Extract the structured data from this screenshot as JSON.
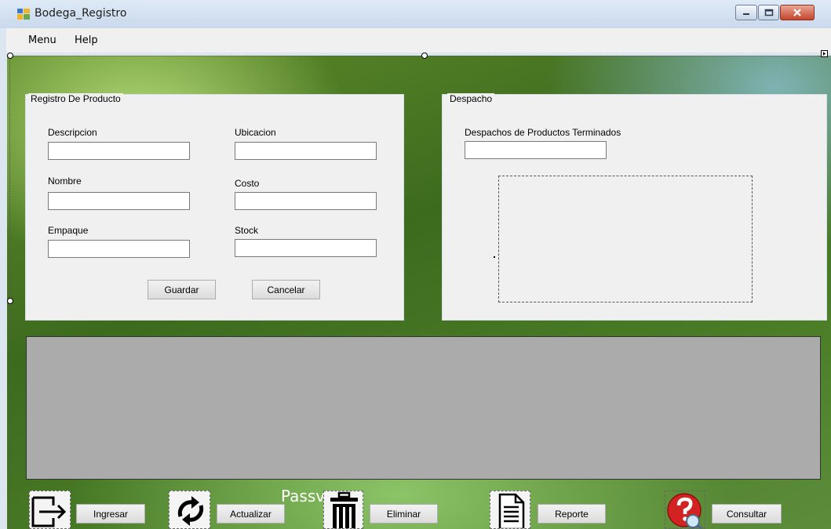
{
  "window": {
    "title": "Bodega_Registro"
  },
  "menu": {
    "items": [
      {
        "label": "Menu"
      },
      {
        "label": "Help"
      }
    ]
  },
  "registro": {
    "title": "Registro De Producto",
    "fields": {
      "descripcion": {
        "label": "Descripcion",
        "value": ""
      },
      "ubicacion": {
        "label": "Ubicacion",
        "value": ""
      },
      "nombre": {
        "label": "Nombre",
        "value": ""
      },
      "costo": {
        "label": "Costo",
        "value": ""
      },
      "empaque": {
        "label": "Empaque",
        "value": ""
      },
      "stock": {
        "label": "Stock",
        "value": ""
      }
    },
    "guardar_label": "Guardar",
    "cancelar_label": "Cancelar"
  },
  "despacho": {
    "title": "Despacho",
    "label": "Despachos de Productos Terminados",
    "value": ""
  },
  "toolbar": {
    "ingresar_label": "Ingresar",
    "actualizar_label": "Actualizar",
    "eliminar_label": "Eliminar",
    "reporte_label": "Reporte",
    "consultar_label": "Consultar"
  },
  "background_text": "Passv",
  "icons": [
    "app-icon",
    "minimize-icon",
    "maximize-icon",
    "close-icon",
    "login-arrow-icon",
    "refresh-icon",
    "trash-icon",
    "document-icon",
    "help-search-icon"
  ],
  "colors": {
    "group_bg": "#f0f0f0",
    "grid_bg": "#ababab",
    "close_red": "#c4452b"
  }
}
